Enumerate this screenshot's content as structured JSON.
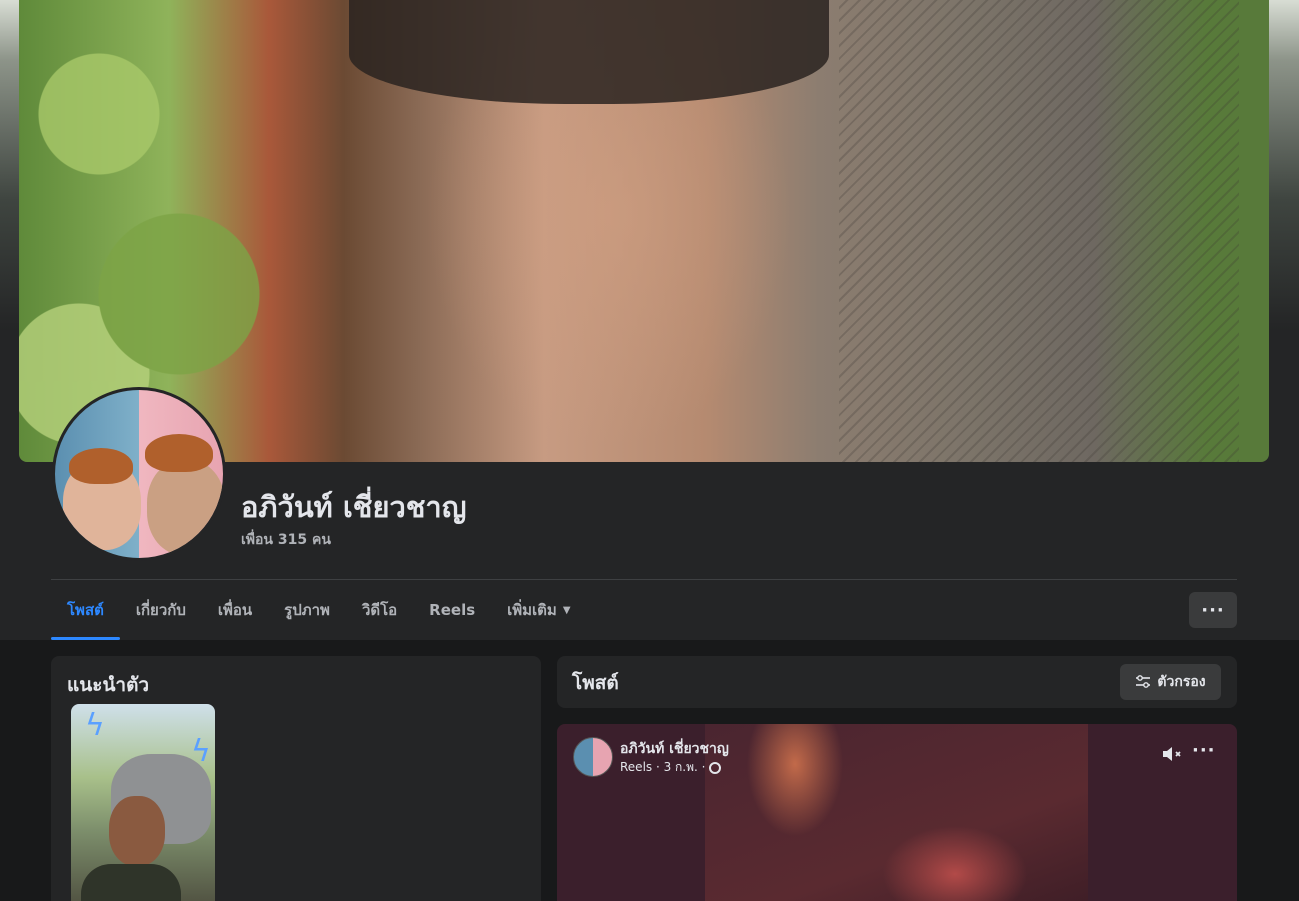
{
  "profile": {
    "name": "อภิวันท์ เชี่ยวชาญ",
    "friends": "เพื่อน 315 คน"
  },
  "tabs": [
    {
      "label": "โพสต์",
      "active": true
    },
    {
      "label": "เกี่ยวกับ"
    },
    {
      "label": "เพื่อน"
    },
    {
      "label": "รูปภาพ"
    },
    {
      "label": "วิดีโอ"
    },
    {
      "label": "Reels"
    },
    {
      "label": "เพิ่มเติม"
    }
  ],
  "more_button": "···",
  "intro": {
    "title": "แนะนำตัว"
  },
  "posts": {
    "title": "โพสต์",
    "filter_label": "ตัวกรอง",
    "reel": {
      "author": "อภิวันท์ เชี่ยวชาญ",
      "meta": "Reels · 3 ก.พ. ·",
      "more": "···"
    }
  },
  "colors": {
    "accent": "#2d88ff",
    "panel": "#242526",
    "background": "#18191a"
  }
}
